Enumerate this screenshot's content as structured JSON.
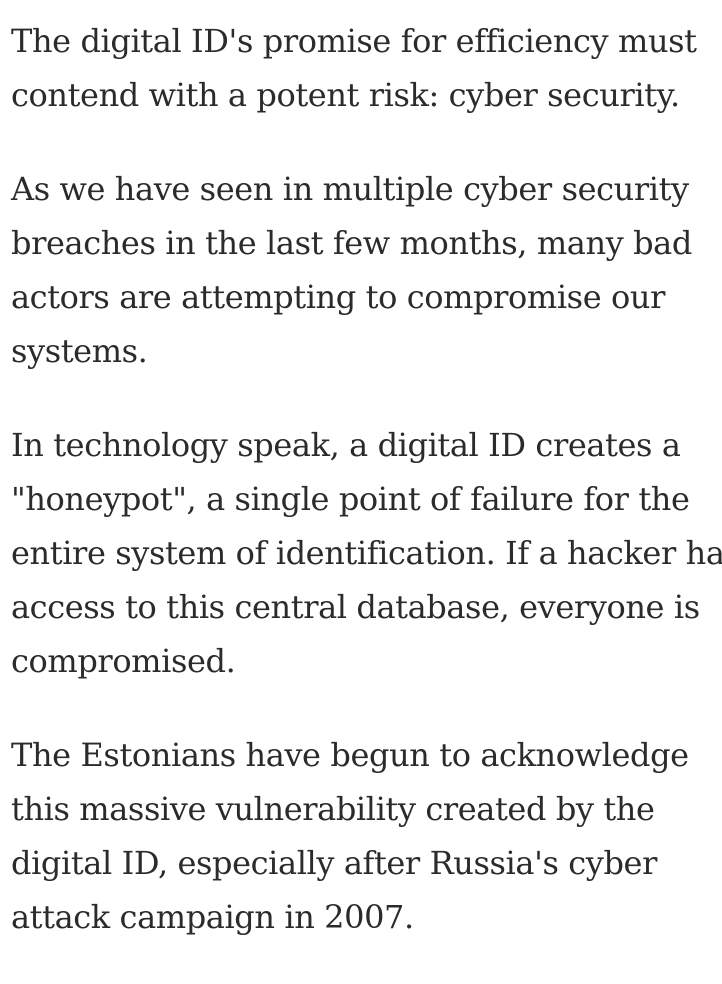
{
  "article": {
    "paragraphs": [
      {
        "lines": [
          "The digital ID's promise for efficiency must",
          "contend with a potent risk: cyber security."
        ]
      },
      {
        "lines": [
          "As we have seen in multiple cyber security",
          "breaches in the last few months, many bad",
          "actors are attempting to compromise our",
          "systems."
        ]
      },
      {
        "lines": [
          "In technology speak, a digital ID creates a",
          "\"honeypot\", a single point of failure for the",
          "entire system of identification. If a hacker has",
          "access to this central database, everyone is",
          "compromised."
        ]
      },
      {
        "lines": [
          "The Estonians have begun to acknowledge",
          "this massive vulnerability created by the",
          "digital ID, especially after Russia's cyber",
          "attack campaign in 2007."
        ]
      }
    ]
  }
}
